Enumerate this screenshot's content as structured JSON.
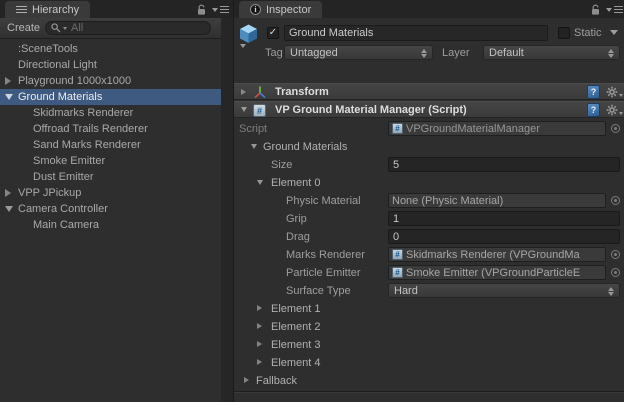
{
  "colors": {
    "selection_blue": "#3e5a80",
    "panel_bg": "#2e2e2e",
    "tab_bg": "#3a3a3a",
    "component_header_bg": "#3f3f3f",
    "field_bg": "#252525",
    "object_field_bg": "#3a3a3a"
  },
  "icons": {
    "check": "✓",
    "help": "?",
    "info": "i",
    "script_glyph": "#"
  },
  "hierarchy": {
    "tab_label": "Hierarchy",
    "toolbar": {
      "create_label": "Create",
      "search_text": "All"
    },
    "items": [
      {
        "label": ":SceneTools",
        "depth": 1,
        "arrow": "none",
        "selected": false
      },
      {
        "label": "Directional Light",
        "depth": 1,
        "arrow": "none",
        "selected": false
      },
      {
        "label": "Playground 1000x1000",
        "depth": 1,
        "arrow": "collapsed",
        "selected": false
      },
      {
        "label": "Ground Materials",
        "depth": 1,
        "arrow": "expanded",
        "selected": true
      },
      {
        "label": "Skidmarks Renderer",
        "depth": 2,
        "arrow": "none",
        "selected": false
      },
      {
        "label": "Offroad Trails Renderer",
        "depth": 2,
        "arrow": "none",
        "selected": false
      },
      {
        "label": "Sand Marks Renderer",
        "depth": 2,
        "arrow": "none",
        "selected": false
      },
      {
        "label": "Smoke Emitter",
        "depth": 2,
        "arrow": "none",
        "selected": false
      },
      {
        "label": "Dust Emitter",
        "depth": 2,
        "arrow": "none",
        "selected": false
      },
      {
        "label": "VPP JPickup",
        "depth": 1,
        "arrow": "collapsed",
        "selected": false
      },
      {
        "label": "Camera Controller",
        "depth": 1,
        "arrow": "expanded",
        "selected": false
      },
      {
        "label": "Main Camera",
        "depth": 2,
        "arrow": "none",
        "selected": false
      }
    ]
  },
  "inspector": {
    "tab_label": "Inspector",
    "game_object": {
      "name": "Ground Materials",
      "active_checked": true,
      "static_label": "Static",
      "tag_label": "Tag",
      "tag_value": "Untagged",
      "layer_label": "Layer",
      "layer_value": "Default"
    },
    "components": [
      {
        "title": "Transform",
        "expanded": false
      },
      {
        "title": "VP Ground Material Manager (Script)",
        "expanded": true
      }
    ],
    "rows": [
      {
        "label": "Script",
        "value": "VPGroundMaterialManager"
      },
      {
        "label": "Ground Materials"
      },
      {
        "label": "Size",
        "value": "5"
      },
      {
        "label": "Element 0"
      },
      {
        "label": "Physic Material",
        "value": "None (Physic Material)"
      },
      {
        "label": "Grip",
        "value": "1"
      },
      {
        "label": "Drag",
        "value": "0"
      },
      {
        "label": "Marks Renderer",
        "value": "Skidmarks Renderer (VPGroundMa"
      },
      {
        "label": "Particle Emitter",
        "value": "Smoke Emitter (VPGroundParticleE"
      },
      {
        "label": "Surface Type",
        "value": "Hard"
      },
      {
        "label": "Element 1"
      },
      {
        "label": "Element 2"
      },
      {
        "label": "Element 3"
      },
      {
        "label": "Element 4"
      },
      {
        "label": "Fallback"
      }
    ]
  }
}
